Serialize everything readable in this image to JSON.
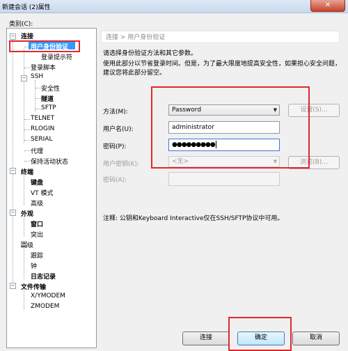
{
  "window": {
    "title": "新建会话 (2)属性",
    "close_label": "✕"
  },
  "category_label": "类别(C):",
  "tree": [
    {
      "label": "连接",
      "bold": true,
      "expander": "−"
    },
    {
      "label": "用户身份验证",
      "bold": true,
      "selected": true
    },
    {
      "label": "登录提示符"
    },
    {
      "label": "登录脚本"
    },
    {
      "label": "SSH",
      "expander": "−"
    },
    {
      "label": "安全性"
    },
    {
      "label": "隧道",
      "bold": true
    },
    {
      "label": "SFTP"
    },
    {
      "label": "TELNET"
    },
    {
      "label": "RLOGIN"
    },
    {
      "label": "SERIAL"
    },
    {
      "label": "代理"
    },
    {
      "label": "保持活动状态"
    },
    {
      "label": "终端",
      "bold": true,
      "expander": "−"
    },
    {
      "label": "键盘",
      "bold": true
    },
    {
      "label": "VT 模式"
    },
    {
      "label": "高级"
    },
    {
      "label": "外观",
      "bold": true,
      "expander": "−"
    },
    {
      "label": "窗口",
      "bold": true
    },
    {
      "label": "突出"
    },
    {
      "label": "高级",
      "expander": "−"
    },
    {
      "label": "跟踪"
    },
    {
      "label": "钟"
    },
    {
      "label": "日志记录",
      "bold": true
    },
    {
      "label": "文件传输",
      "bold": true,
      "expander": "−"
    },
    {
      "label": "X/YMODEM"
    },
    {
      "label": "ZMODEM"
    }
  ],
  "breadcrumb": "连接 > 用户身份验证",
  "description": {
    "line1": "请选择身份验证方法和其它参数。",
    "line2": "使用此部分以节省登录时间。但是，为了最大限度地提高安全性，如果担心安全问题，",
    "line3": "建议您将此部分留空。"
  },
  "form": {
    "method_label": "方法(M):",
    "method_value": "Password",
    "settings_button": "设置(S)...",
    "username_label": "用户名(U):",
    "username_value": "administrator",
    "password_label": "密码(P):",
    "password_value": "●●●●●●●●●",
    "user_key_label": "用户密钥(K):",
    "user_key_value": "<无>",
    "browse_button": "浏览(B)...",
    "passphrase_label": "密码(A):"
  },
  "note": "注释: 公钥和Keyboard Interactive仅在SSH/SFTP协议中可用。",
  "buttons": {
    "connect": "连接",
    "ok": "确定",
    "cancel": "取消"
  },
  "colors": {
    "selection": "#3399ff",
    "highlight_box": "#e0262e"
  }
}
